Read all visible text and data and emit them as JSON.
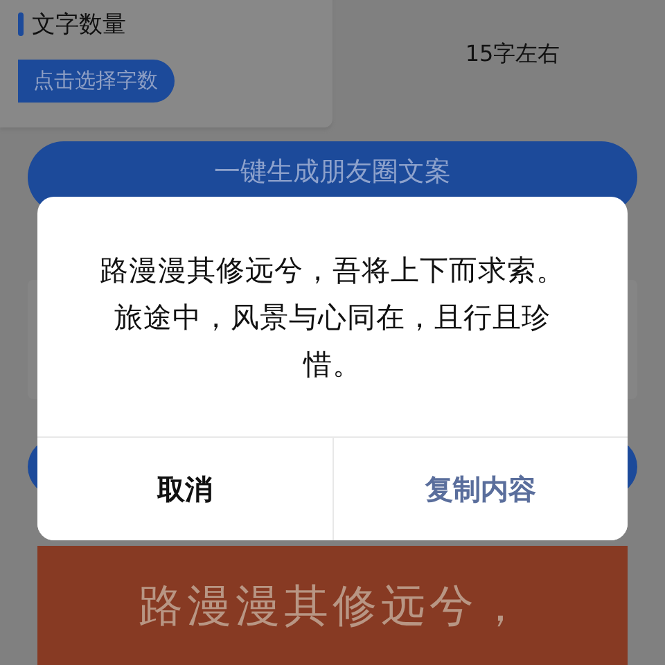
{
  "word_count_card": {
    "title": "文字数量",
    "button": "点击选择字数"
  },
  "word_count_value": "15字左右",
  "generate_button": "一键生成朋友圈文案",
  "preview_card": {
    "text": "路漫漫其修远兮，"
  },
  "dialog": {
    "message": "路漫漫其修远兮，吾将上下而求索。旅途中，风景与心同在，且行且珍惜。",
    "buttons": [
      {
        "label": "取消",
        "kind": "cancel"
      },
      {
        "label": "复制内容",
        "kind": "confirm"
      }
    ]
  }
}
